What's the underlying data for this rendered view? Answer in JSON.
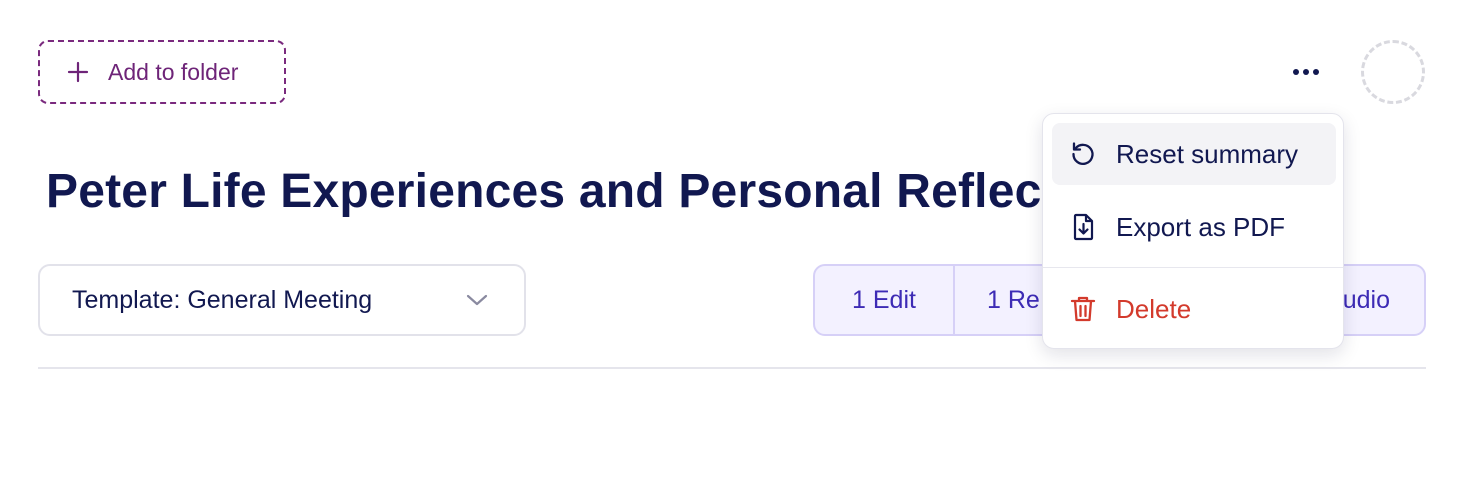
{
  "header": {
    "add_folder_label": "Add to folder"
  },
  "page": {
    "title": "Peter Life Experiences and Personal Reflections"
  },
  "template_select": {
    "value": "Template: General Meeting"
  },
  "tabs": [
    {
      "label": "1 Edit"
    },
    {
      "label": "1 Re"
    },
    {
      "label": "udio"
    }
  ],
  "menu": {
    "items": [
      {
        "label": "Reset summary",
        "icon": "reset-icon"
      },
      {
        "label": "Export as PDF",
        "icon": "file-download-icon"
      },
      {
        "label": "Delete",
        "icon": "trash-icon",
        "color": "#d33a2c"
      }
    ]
  },
  "colors": {
    "primary_text": "#111850",
    "folder_accent": "#6e2478",
    "tab_accent": "#3d2bb5",
    "danger": "#d33a2c"
  }
}
